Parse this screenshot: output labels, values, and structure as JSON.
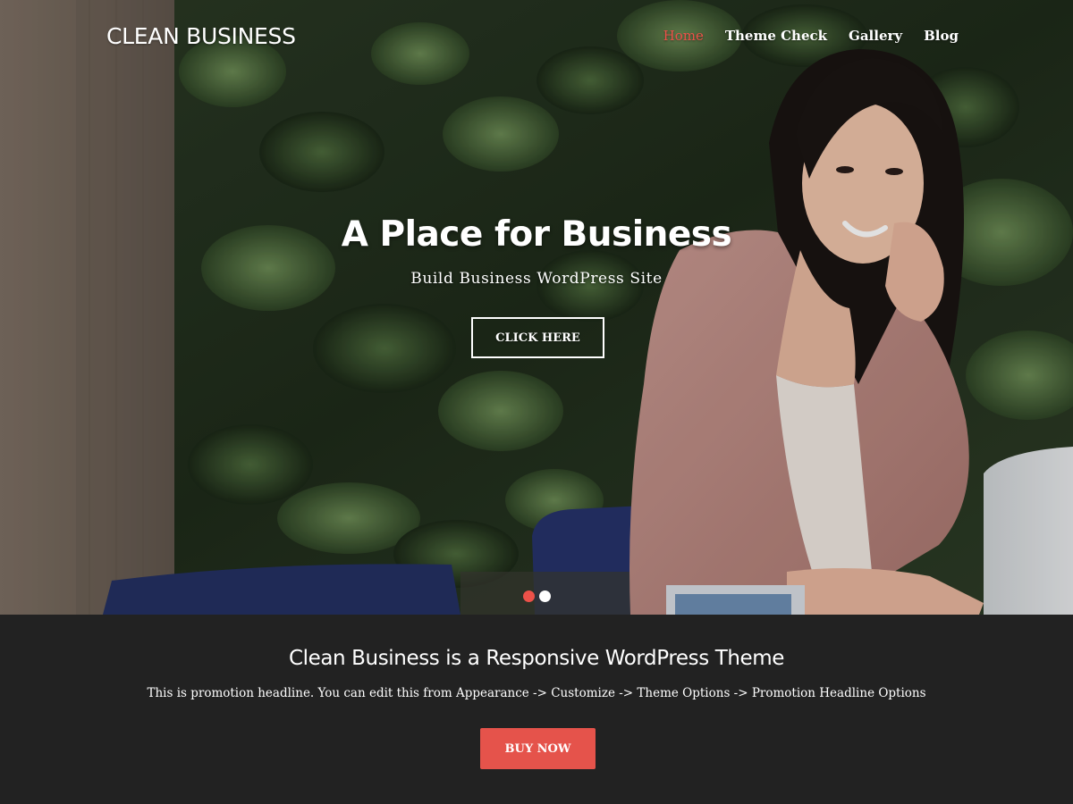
{
  "header": {
    "site_title": "CLEAN BUSINESS",
    "nav": [
      {
        "label": "Home",
        "active": true
      },
      {
        "label": "Theme Check",
        "active": false
      },
      {
        "label": "Gallery",
        "active": false
      },
      {
        "label": "Blog",
        "active": false
      }
    ]
  },
  "hero": {
    "title": "A Place for Business",
    "subtitle": "Build Business WordPress Site",
    "button_label": "CLICK HERE",
    "slides_total": 2,
    "active_slide": 1
  },
  "promotion": {
    "title": "Clean Business is a Responsive WordPress Theme",
    "text": "This is promotion headline. You can edit this from Appearance -> Customize -> Theme Options -> Promotion Headline Options",
    "button_label": "BUY NOW"
  },
  "colors": {
    "accent": "#ec5149",
    "button": "#e5534b",
    "promo_background": "#222222"
  }
}
